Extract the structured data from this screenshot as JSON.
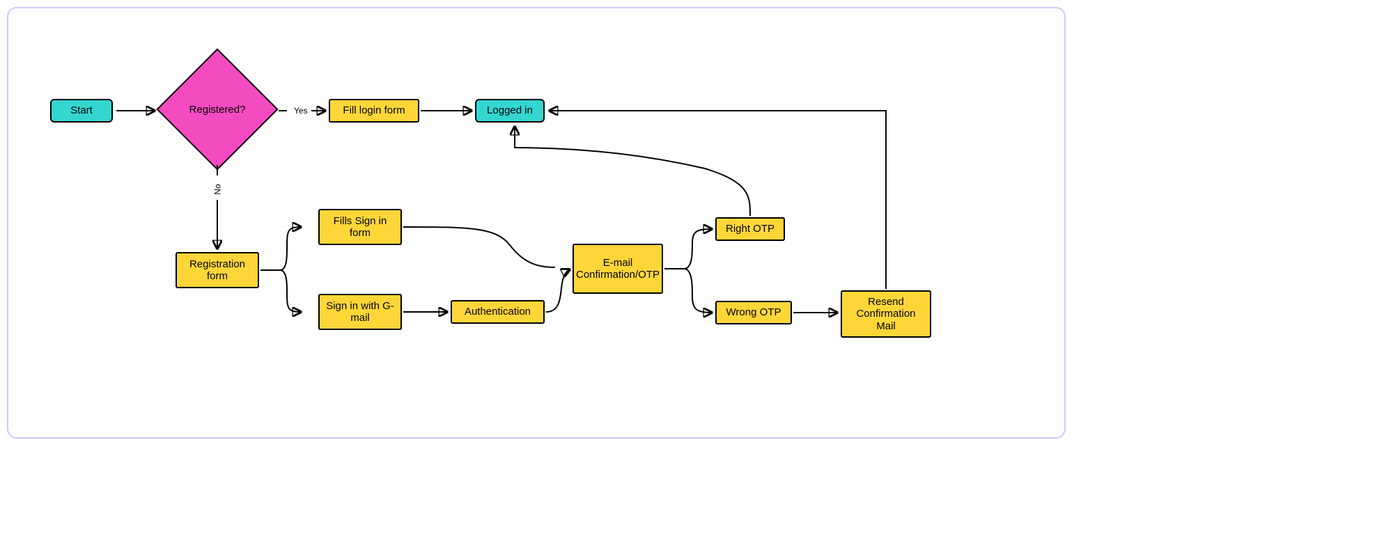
{
  "colors": {
    "frame_border": "#c9c9ff",
    "teal": "#33d6d0",
    "yellow": "#ffd638",
    "pink": "#f54bc0"
  },
  "nodes": {
    "start": "Start",
    "registered_q": "Registered?",
    "fill_login": "Fill login form",
    "logged_in": "Logged in",
    "registration_form": "Registration form",
    "fills_signin": "Fills Sign in form",
    "signin_gmail": "Sign in with G-mail",
    "authentication": "Authentication",
    "email_conf": "E-mail Confirmation/OTP",
    "right_otp": "Right OTP",
    "wrong_otp": "Wrong OTP",
    "resend_mail": "Resend Confirmation Mail"
  },
  "edge_labels": {
    "yes": "Yes",
    "no": "No"
  }
}
